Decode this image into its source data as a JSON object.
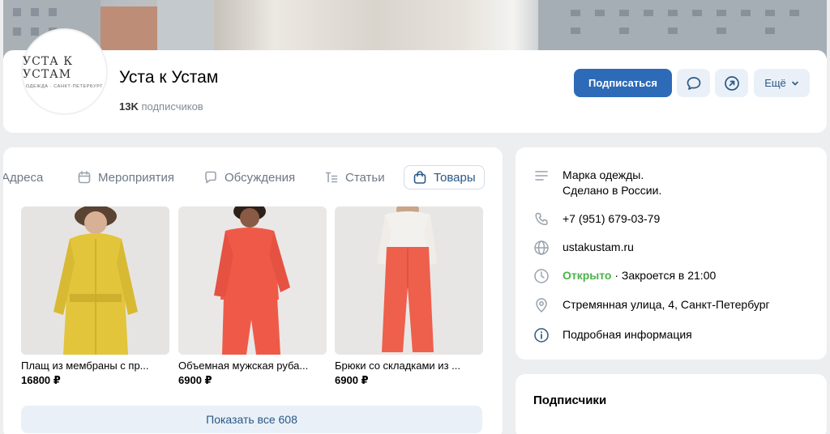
{
  "group": {
    "avatar_line1": "УСТА К УСТАМ",
    "avatar_line2": "ОДЕЖДА · САНКТ-ПЕТЕРБУРГ",
    "title": "Уста к Устам",
    "subscribers_count": "13K",
    "subscribers_label": "подписчиков"
  },
  "actions": {
    "subscribe_label": "Подписаться",
    "more_label": "Ещё"
  },
  "tabs": [
    {
      "label": "Адреса",
      "icon": "location-icon"
    },
    {
      "label": "Мероприятия",
      "icon": "calendar-icon"
    },
    {
      "label": "Обсуждения",
      "icon": "chat-icon"
    },
    {
      "label": "Статьи",
      "icon": "article-icon"
    },
    {
      "label": "Товары",
      "icon": "bag-icon",
      "active": true
    }
  ],
  "products": [
    {
      "name": "Плащ из мембраны с пр...",
      "price": "16800 ₽",
      "color": "#e2c53a"
    },
    {
      "name": "Объемная мужская руба...",
      "price": "6900 ₽",
      "color": "#ef5a48"
    },
    {
      "name": "Брюки со складками из ...",
      "price": "6900 ₽",
      "color": "#ee5f4c"
    }
  ],
  "show_all_label": "Показать все 608",
  "info": {
    "description_line1": "Марка одежды.",
    "description_line2": "Сделано в России.",
    "phone": "+7 (951) 679-03-79",
    "website": "ustakustam.ru",
    "open_status": "Открыто",
    "close_time": " · Закроется в 21:00",
    "address": "Стремянная улица, 4, Санкт-Петербург",
    "details": "Подробная информация"
  },
  "subscribers_section_title": "Подписчики",
  "colors": {
    "accent": "#2d6ab8",
    "link": "#2a5885",
    "open_green": "#4bb34b"
  }
}
